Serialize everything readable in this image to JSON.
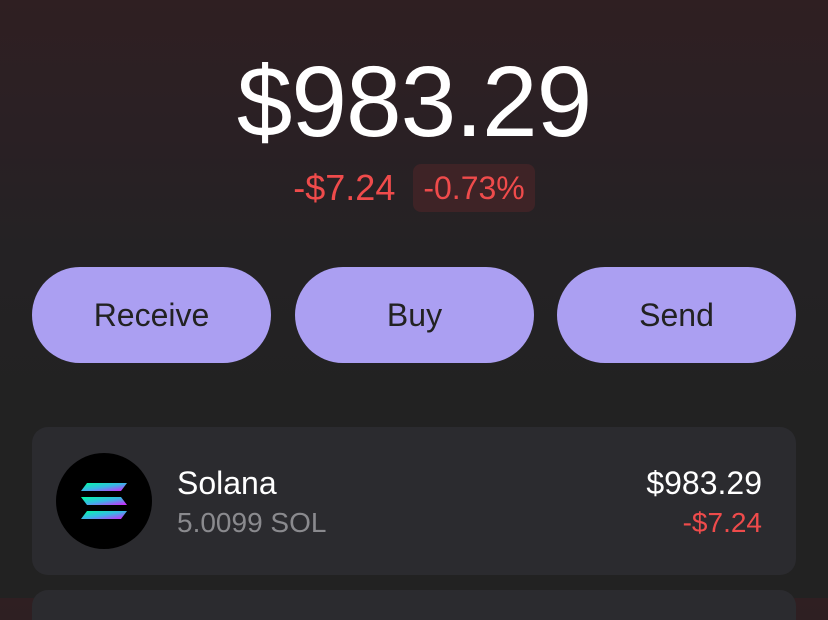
{
  "portfolio": {
    "balance": "$983.29",
    "change_amount": "-$7.24",
    "change_percent": "-0.73%"
  },
  "actions": {
    "receive_label": "Receive",
    "buy_label": "Buy",
    "send_label": "Send"
  },
  "tokens": [
    {
      "name": "Solana",
      "amount": "5.0099 SOL",
      "value": "$983.29",
      "change": "-$7.24",
      "icon": "solana-logo-icon"
    }
  ],
  "colors": {
    "accent": "#ab9ff2",
    "negative": "#ef4b4b",
    "card": "#2b2b2f",
    "muted_text": "#8a8a8e"
  }
}
